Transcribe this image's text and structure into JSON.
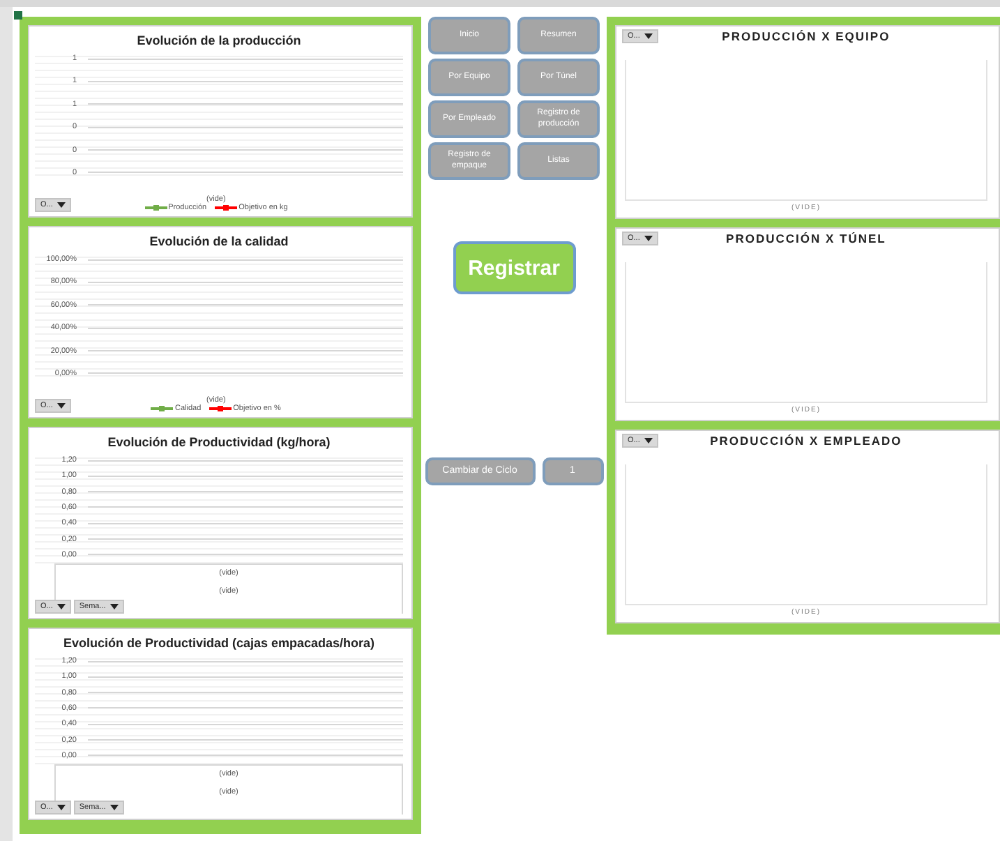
{
  "left_charts": [
    {
      "kind": "legend",
      "title": "Evolución de la producción",
      "y_labels": [
        "1",
        "1",
        "1",
        "0",
        "0",
        "0"
      ],
      "axis_label": "(vide)",
      "filters": [
        "O..."
      ],
      "legend": [
        {
          "label": "Producción",
          "color": "#70ad47"
        },
        {
          "label": "Objetivo en kg",
          "color": "#ff0000"
        }
      ]
    },
    {
      "kind": "legend",
      "title": "Evolución de la calidad",
      "y_labels": [
        "100,00%",
        "80,00%",
        "60,00%",
        "40,00%",
        "20,00%",
        "0,00%"
      ],
      "axis_label": "(vide)",
      "filters": [
        "O..."
      ],
      "legend": [
        {
          "label": "Calidad",
          "color": "#70ad47"
        },
        {
          "label": "Objetivo en %",
          "color": "#ff0000"
        }
      ]
    },
    {
      "kind": "fields",
      "title": "Evolución de Productividad (kg/hora)",
      "y_labels": [
        "1,20",
        "1,00",
        "0,80",
        "0,60",
        "0,40",
        "0,20",
        "0,00"
      ],
      "field_items": [
        "(vide)",
        "(vide)"
      ],
      "filters": [
        "O...",
        "Sema..."
      ]
    },
    {
      "kind": "fields",
      "title": "Evolución de Productividad (cajas empacadas/hora)",
      "y_labels": [
        "1,20",
        "1,00",
        "0,80",
        "0,60",
        "0,40",
        "0,20",
        "0,00"
      ],
      "field_items": [
        "(vide)",
        "(vide)"
      ],
      "filters": [
        "O...",
        "Sema..."
      ]
    }
  ],
  "nav_buttons": [
    "Inicio",
    "Por Equipo",
    "Por Empleado",
    "Registro de empaque",
    "Resumen",
    "Por Túnel",
    "Registro de producción",
    "Listas"
  ],
  "register_button": "Registrar",
  "cycle": {
    "label": "Cambiar de Ciclo",
    "value": "1"
  },
  "right_charts": [
    {
      "title": "PRODUCCIÓN X EQUIPO",
      "filter": "O...",
      "footer": "(VIDE)"
    },
    {
      "title": "PRODUCCIÓN X TÚNEL",
      "filter": "O...",
      "footer": "(VIDE)"
    },
    {
      "title": "PRODUCCIÓN X EMPLEADO",
      "filter": "O...",
      "footer": "(VIDE)"
    }
  ]
}
